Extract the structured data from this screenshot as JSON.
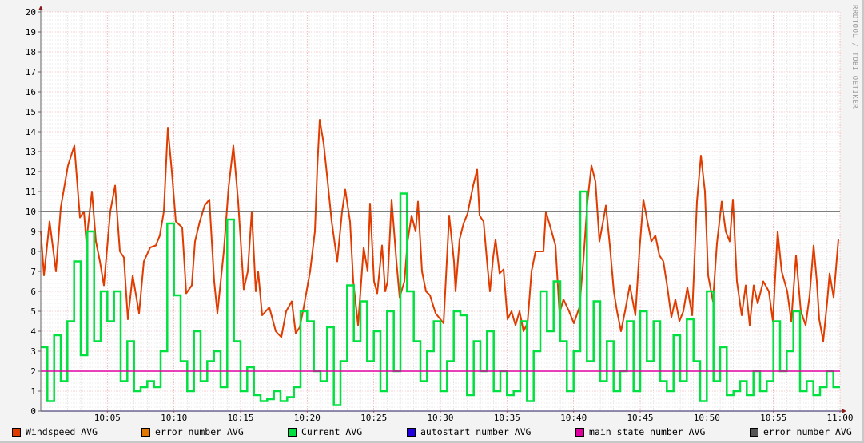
{
  "watermark": "RRDTOOL / TOBI OETIKER",
  "chart_data": {
    "type": "line",
    "title": "",
    "xlabel": "",
    "ylabel": "",
    "ylim": [
      0,
      20
    ],
    "xlim_minutes_after_10_00": [
      0,
      60
    ],
    "y_ticks": [
      "0",
      "1",
      "2",
      "3",
      "4",
      "5",
      "6",
      "7",
      "8",
      "9",
      "10",
      "11",
      "12",
      "13",
      "14",
      "15",
      "16",
      "17",
      "18",
      "19",
      "20"
    ],
    "x_ticks": [
      {
        "minute": 5,
        "label": "10:05"
      },
      {
        "minute": 10,
        "label": "10:10"
      },
      {
        "minute": 15,
        "label": "10:15"
      },
      {
        "minute": 20,
        "label": "10:20"
      },
      {
        "minute": 25,
        "label": "10:25"
      },
      {
        "minute": 30,
        "label": "10:30"
      },
      {
        "minute": 35,
        "label": "10:35"
      },
      {
        "minute": 40,
        "label": "10:40"
      },
      {
        "minute": 45,
        "label": "10:45"
      },
      {
        "minute": 50,
        "label": "10:50"
      },
      {
        "minute": 55,
        "label": "10:55"
      },
      {
        "minute": 60,
        "label": "11:00"
      }
    ],
    "grid": true,
    "legend_placement": "bottom",
    "legend": [
      {
        "label": "Windspeed AVG",
        "color": "#e03c00"
      },
      {
        "label": "error_number AVG",
        "color": "#e07800"
      },
      {
        "label": "Current AVG",
        "color": "#00e040"
      },
      {
        "label": "autostart_number AVG",
        "color": "#2000e0"
      },
      {
        "label": "main_state_number AVG",
        "color": "#e000a0"
      },
      {
        "label": "error_number AVG",
        "color": "#555555"
      }
    ],
    "series": [
      {
        "name": "Windspeed AVG",
        "color": "#e03c00",
        "points": [
          [
            0,
            9
          ],
          [
            0.24,
            6.8
          ],
          [
            0.66,
            9.5
          ],
          [
            1.14,
            7
          ],
          [
            1.5,
            10.2
          ],
          [
            2.04,
            12.3
          ],
          [
            2.52,
            13.3
          ],
          [
            2.94,
            9.7
          ],
          [
            3.24,
            10
          ],
          [
            3.42,
            8.5
          ],
          [
            3.84,
            11
          ],
          [
            4.14,
            8.5
          ],
          [
            4.44,
            7.5
          ],
          [
            4.74,
            6.3
          ],
          [
            5.22,
            10
          ],
          [
            5.58,
            11.3
          ],
          [
            5.94,
            8
          ],
          [
            6.24,
            7.7
          ],
          [
            6.54,
            4.6
          ],
          [
            6.9,
            6.8
          ],
          [
            7.38,
            4.9
          ],
          [
            7.74,
            7.5
          ],
          [
            8.22,
            8.2
          ],
          [
            8.64,
            8.3
          ],
          [
            8.94,
            8.8
          ],
          [
            9.24,
            10
          ],
          [
            9.54,
            14.2
          ],
          [
            9.84,
            12
          ],
          [
            10.14,
            9.5
          ],
          [
            10.62,
            9.2
          ],
          [
            10.92,
            5.9
          ],
          [
            11.34,
            6.3
          ],
          [
            11.58,
            8.5
          ],
          [
            11.94,
            9.5
          ],
          [
            12.3,
            10.3
          ],
          [
            12.66,
            10.6
          ],
          [
            12.84,
            8.5
          ],
          [
            13.02,
            6.5
          ],
          [
            13.26,
            4.9
          ],
          [
            13.74,
            8
          ],
          [
            14.1,
            11.2
          ],
          [
            14.46,
            13.3
          ],
          [
            14.82,
            10.5
          ],
          [
            15.24,
            6.1
          ],
          [
            15.54,
            7
          ],
          [
            15.84,
            10
          ],
          [
            16.14,
            6
          ],
          [
            16.32,
            7
          ],
          [
            16.62,
            4.8
          ],
          [
            17.16,
            5.2
          ],
          [
            17.64,
            4
          ],
          [
            18.06,
            3.7
          ],
          [
            18.42,
            5
          ],
          [
            18.84,
            5.5
          ],
          [
            19.14,
            3.9
          ],
          [
            19.44,
            4.2
          ],
          [
            19.74,
            5.2
          ],
          [
            20.22,
            7
          ],
          [
            20.58,
            9
          ],
          [
            20.76,
            12.2
          ],
          [
            20.94,
            14.6
          ],
          [
            21.24,
            13.4
          ],
          [
            21.54,
            11.5
          ],
          [
            21.84,
            9.5
          ],
          [
            22.26,
            7.5
          ],
          [
            22.62,
            10
          ],
          [
            22.86,
            11.1
          ],
          [
            23.22,
            9.5
          ],
          [
            23.46,
            6.5
          ],
          [
            23.82,
            4.3
          ],
          [
            24.24,
            8.2
          ],
          [
            24.54,
            7
          ],
          [
            24.72,
            10.4
          ],
          [
            25.02,
            6.5
          ],
          [
            25.26,
            5.9
          ],
          [
            25.62,
            8.3
          ],
          [
            25.86,
            6
          ],
          [
            26.04,
            6.5
          ],
          [
            26.34,
            10.6
          ],
          [
            26.7,
            7.5
          ],
          [
            26.94,
            5.7
          ],
          [
            27.3,
            6.5
          ],
          [
            27.54,
            8.5
          ],
          [
            27.84,
            9.8
          ],
          [
            28.14,
            9
          ],
          [
            28.32,
            10.5
          ],
          [
            28.62,
            7
          ],
          [
            28.92,
            6
          ],
          [
            29.22,
            5.8
          ],
          [
            29.64,
            4.9
          ],
          [
            30.24,
            4.4
          ],
          [
            30.66,
            9.8
          ],
          [
            31.02,
            7.5
          ],
          [
            31.14,
            6
          ],
          [
            31.44,
            8.6
          ],
          [
            31.74,
            9.4
          ],
          [
            32.04,
            9.9
          ],
          [
            32.46,
            11.3
          ],
          [
            32.76,
            12.1
          ],
          [
            32.94,
            9.8
          ],
          [
            33.24,
            9.5
          ],
          [
            33.54,
            7.2
          ],
          [
            33.72,
            6
          ],
          [
            33.96,
            7.7
          ],
          [
            34.14,
            8.6
          ],
          [
            34.44,
            6.9
          ],
          [
            34.74,
            7.1
          ],
          [
            35.04,
            4.6
          ],
          [
            35.34,
            5
          ],
          [
            35.64,
            4.3
          ],
          [
            35.94,
            5
          ],
          [
            36.24,
            4
          ],
          [
            36.54,
            4.4
          ],
          [
            36.84,
            7
          ],
          [
            37.14,
            8
          ],
          [
            37.74,
            8
          ],
          [
            37.92,
            10
          ],
          [
            38.22,
            9.3
          ],
          [
            38.64,
            8.3
          ],
          [
            38.94,
            4.9
          ],
          [
            39.24,
            5.6
          ],
          [
            39.66,
            5
          ],
          [
            40.02,
            4.4
          ],
          [
            40.44,
            5.2
          ],
          [
            40.74,
            7.6
          ],
          [
            41.04,
            10.5
          ],
          [
            41.34,
            12.3
          ],
          [
            41.64,
            11.5
          ],
          [
            41.94,
            8.5
          ],
          [
            42.24,
            9.6
          ],
          [
            42.42,
            10.3
          ],
          [
            42.72,
            8.3
          ],
          [
            43.02,
            6
          ],
          [
            43.26,
            5
          ],
          [
            43.56,
            4
          ],
          [
            43.86,
            5
          ],
          [
            44.22,
            6.3
          ],
          [
            44.64,
            4.8
          ],
          [
            44.94,
            8
          ],
          [
            45.24,
            10.6
          ],
          [
            45.54,
            9.5
          ],
          [
            45.84,
            8.5
          ],
          [
            46.14,
            8.8
          ],
          [
            46.44,
            7.8
          ],
          [
            46.74,
            7.5
          ],
          [
            47.04,
            6.2
          ],
          [
            47.34,
            4.7
          ],
          [
            47.64,
            5.6
          ],
          [
            47.94,
            4.5
          ],
          [
            48.24,
            5
          ],
          [
            48.54,
            6.2
          ],
          [
            48.9,
            4.8
          ],
          [
            49.26,
            10.5
          ],
          [
            49.56,
            12.8
          ],
          [
            49.86,
            11
          ],
          [
            50.1,
            6.8
          ],
          [
            50.46,
            5.5
          ],
          [
            50.76,
            8.4
          ],
          [
            51.12,
            10.5
          ],
          [
            51.42,
            9
          ],
          [
            51.72,
            8.5
          ],
          [
            51.96,
            10.6
          ],
          [
            52.26,
            6.5
          ],
          [
            52.62,
            4.8
          ],
          [
            52.92,
            6.3
          ],
          [
            53.22,
            4.3
          ],
          [
            53.52,
            6.3
          ],
          [
            53.82,
            5.4
          ],
          [
            54.24,
            6.5
          ],
          [
            54.66,
            6
          ],
          [
            54.96,
            4.5
          ],
          [
            55.32,
            9
          ],
          [
            55.62,
            7
          ],
          [
            56.04,
            6
          ],
          [
            56.34,
            4.5
          ],
          [
            56.7,
            7.8
          ],
          [
            57.06,
            5
          ],
          [
            57.42,
            4.3
          ],
          [
            57.72,
            5.8
          ],
          [
            58.02,
            8.3
          ],
          [
            58.26,
            6.5
          ],
          [
            58.44,
            4.6
          ],
          [
            58.74,
            3.5
          ],
          [
            59.04,
            5.5
          ],
          [
            59.22,
            6.9
          ],
          [
            59.52,
            5.7
          ],
          [
            59.88,
            8.6
          ]
        ]
      },
      {
        "name": "Current AVG",
        "color": "#00e040",
        "step_minutes": 0.5,
        "values": [
          3.2,
          0.5,
          3.8,
          1.5,
          4.5,
          7.5,
          2.8,
          9.0,
          3.5,
          6.0,
          4.5,
          6.0,
          1.5,
          3.5,
          1.0,
          1.2,
          1.5,
          1.2,
          3.0,
          9.4,
          5.8,
          2.5,
          1.0,
          4.0,
          1.5,
          2.5,
          3.0,
          1.2,
          9.6,
          3.5,
          1.0,
          2.2,
          0.8,
          0.5,
          0.6,
          1.0,
          0.5,
          0.7,
          1.2,
          5.0,
          4.5,
          2.0,
          1.5,
          4.2,
          0.3,
          2.5,
          6.3,
          3.5,
          5.5,
          2.5,
          4.0,
          1.0,
          5.0,
          2.0,
          10.9,
          6.0,
          3.5,
          1.5,
          3.0,
          4.5,
          1.0,
          2.5,
          5.0,
          4.8,
          0.8,
          3.5,
          2.0,
          4.0,
          1.0,
          2.0,
          0.8,
          1.0,
          4.5,
          0.5,
          3.0,
          6.0,
          4.0,
          6.5,
          3.5,
          1.0,
          3.0,
          11.0,
          2.5,
          5.5,
          1.5,
          3.5,
          1.0,
          2.0,
          4.5,
          1.0,
          5.0,
          2.5,
          4.5,
          1.5,
          1.0,
          3.8,
          1.5,
          4.6,
          2.5,
          0.5,
          6.0,
          1.5,
          3.2,
          0.8,
          1.0,
          1.5,
          0.8,
          2.0,
          1.0,
          1.5,
          4.5,
          2.0,
          3.0,
          5.0,
          1.0,
          1.5,
          0.8,
          1.2,
          2.0,
          1.2
        ]
      },
      {
        "name": "main_state_number AVG",
        "color": "#e000a0",
        "constant": 2
      },
      {
        "name": "error_number AVG",
        "color": "#555555",
        "constant": 10
      },
      {
        "name": "autostart_number AVG",
        "color": "#2000e0",
        "constant": 0
      },
      {
        "name": "error_number AVG (orange)",
        "color": "#e07800",
        "constant": 0
      }
    ]
  }
}
